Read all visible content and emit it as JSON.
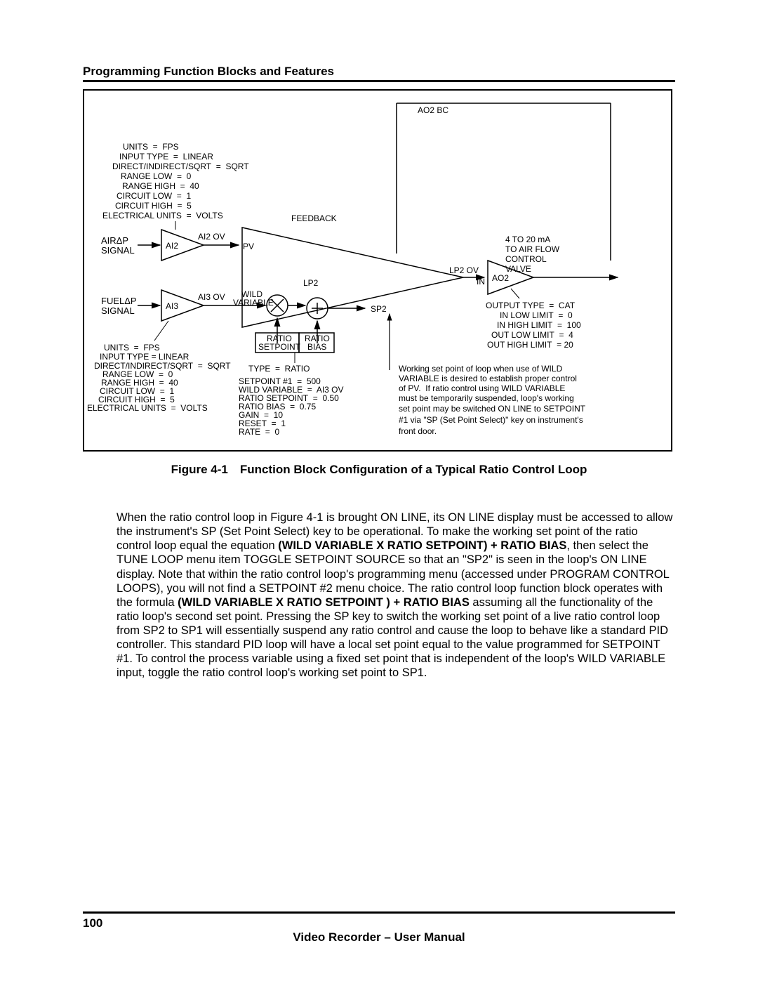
{
  "header": {
    "section_title": "Programming Function Blocks and Features"
  },
  "figure": {
    "caption": "Figure 4-1 Function Block Configuration of a Typical Ratio Control Loop",
    "top_label": "AO2 BC",
    "feedback_label": "FEEDBACK",
    "ai2_cfg": {
      "l1": "UNITS  =  FPS",
      "l2": "INPUT TYPE  =  LINEAR",
      "l3": "DIRECT/INDIRECT/SQRT  =  SQRT",
      "l4": "RANGE LOW  =  0",
      "l5": "RANGE HIGH  =  40",
      "l6": "CIRCUIT LOW  =  1",
      "l7": "CIRCUIT HIGH  =  5",
      "l8": "ELECTRICAL UNITS  =  VOLTS"
    },
    "ai3_cfg": {
      "l1": "UNITS  =  FPS",
      "l2": "INPUT TYPE = LINEAR",
      "l3": "DIRECT/INDIRECT/SQRT  =  SQRT",
      "l4": "RANGE LOW  =  0",
      "l5": "RANGE HIGH  =  40",
      "l6": "CIRCUIT LOW  =  1",
      "l7": "CIRCUIT HIGH  =  5",
      "l8": "ELECTRICAL UNITS  =  VOLTS"
    },
    "sig_air_1": "AIRΔP",
    "sig_air_2": "SIGNAL",
    "sig_fuel_1": "FUELΔP",
    "sig_fuel_2": "SIGNAL",
    "ai2_name": "AI2",
    "ai2_ov": "AI2 OV",
    "ai3_name": "AI3",
    "ai3_ov": "AI3 OV",
    "pv_label": "PV",
    "lp2_label": "LP2",
    "lp2_ov": "LP2 OV",
    "wild_1": "WILD",
    "wild_2": "VARIABLE",
    "sp2_label": "SP2",
    "ratio_setpoint_1": "RATIO",
    "ratio_setpoint_2": "SETPOINT",
    "ratio_bias_1": "RATIO",
    "ratio_bias_2": "BIAS",
    "ao2_in": "IN",
    "ao2_name": "AO2",
    "out_1": "4 TO 20 mA",
    "out_2": "TO AIR FLOW",
    "out_3": "CONTROL",
    "out_4": "VALVE",
    "ao2_cfg": {
      "l1": "OUTPUT TYPE  =  CAT",
      "l2": "IN LOW LIMIT  =  0",
      "l3": "IN HIGH LIMIT  =  100",
      "l4": "OUT LOW LIMIT  =  4",
      "l5": "OUT HIGH LIMIT  = 20"
    },
    "lp2_cfg": {
      "l1": "TYPE  =  RATIO",
      "l2": "SETPOINT #1  =  500",
      "l3": "WILD VARIABLE  =  AI3 OV",
      "l4": "RATIO SETPOINT  =  0.50",
      "l5": "RATIO BIAS  =  0.75",
      "l6": "GAIN  =  10",
      "l7": "RESET  =  1",
      "l8": "RATE  =  0"
    },
    "note": {
      "l1": "Working set point of loop when use of WILD",
      "l2": "VARIABLE is desired to establish proper control",
      "l3": "of PV.  If ratio control using WILD VARIABLE",
      "l4": "must be temporarily suspended, loop's working",
      "l5": "set point may be switched ON LINE to SETPOINT",
      "l6": "#1 via \"SP (Set Point Select)\" key on instrument's",
      "l7": "front door."
    }
  },
  "body": {
    "p1a": "When the ratio control loop in Figure 4-1 is brought ON LINE, its ON LINE display must be accessed to allow the instrument's SP (Set Point Select) key to be operational. To make the working set point of the ratio control loop equal the equation ",
    "p1b": "(WILD VARIABLE X RATIO SETPOINT) + RATIO BIAS",
    "p1c": ", then select the TUNE LOOP menu item TOGGLE SETPOINT SOURCE so that an \"SP2\" is seen in the loop's ON LINE display. Note that within the ratio control loop's programming menu (accessed under PROGRAM CONTROL LOOPS), you will not find a SETPOINT #2 menu choice. The ratio control loop function block operates with the formula ",
    "p1d": "(WILD VARIABLE X RATIO SETPOINT ) + RATIO BIAS",
    "p1e": " assuming all the functionality of the ratio loop's second set point. Pressing the SP key to switch the working set point of a live ratio control loop from SP2 to SP1 will essentially suspend any ratio control and cause the loop to behave like a standard PID controller. This standard PID loop will have a local set point equal to the value programmed for SETPOINT #1. To control the process variable using a fixed set point that is independent of the loop's WILD VARIABLE input, toggle the ratio control loop's working set point to SP1."
  },
  "footer": {
    "page": "100",
    "doc_title": "Video Recorder – User Manual"
  }
}
